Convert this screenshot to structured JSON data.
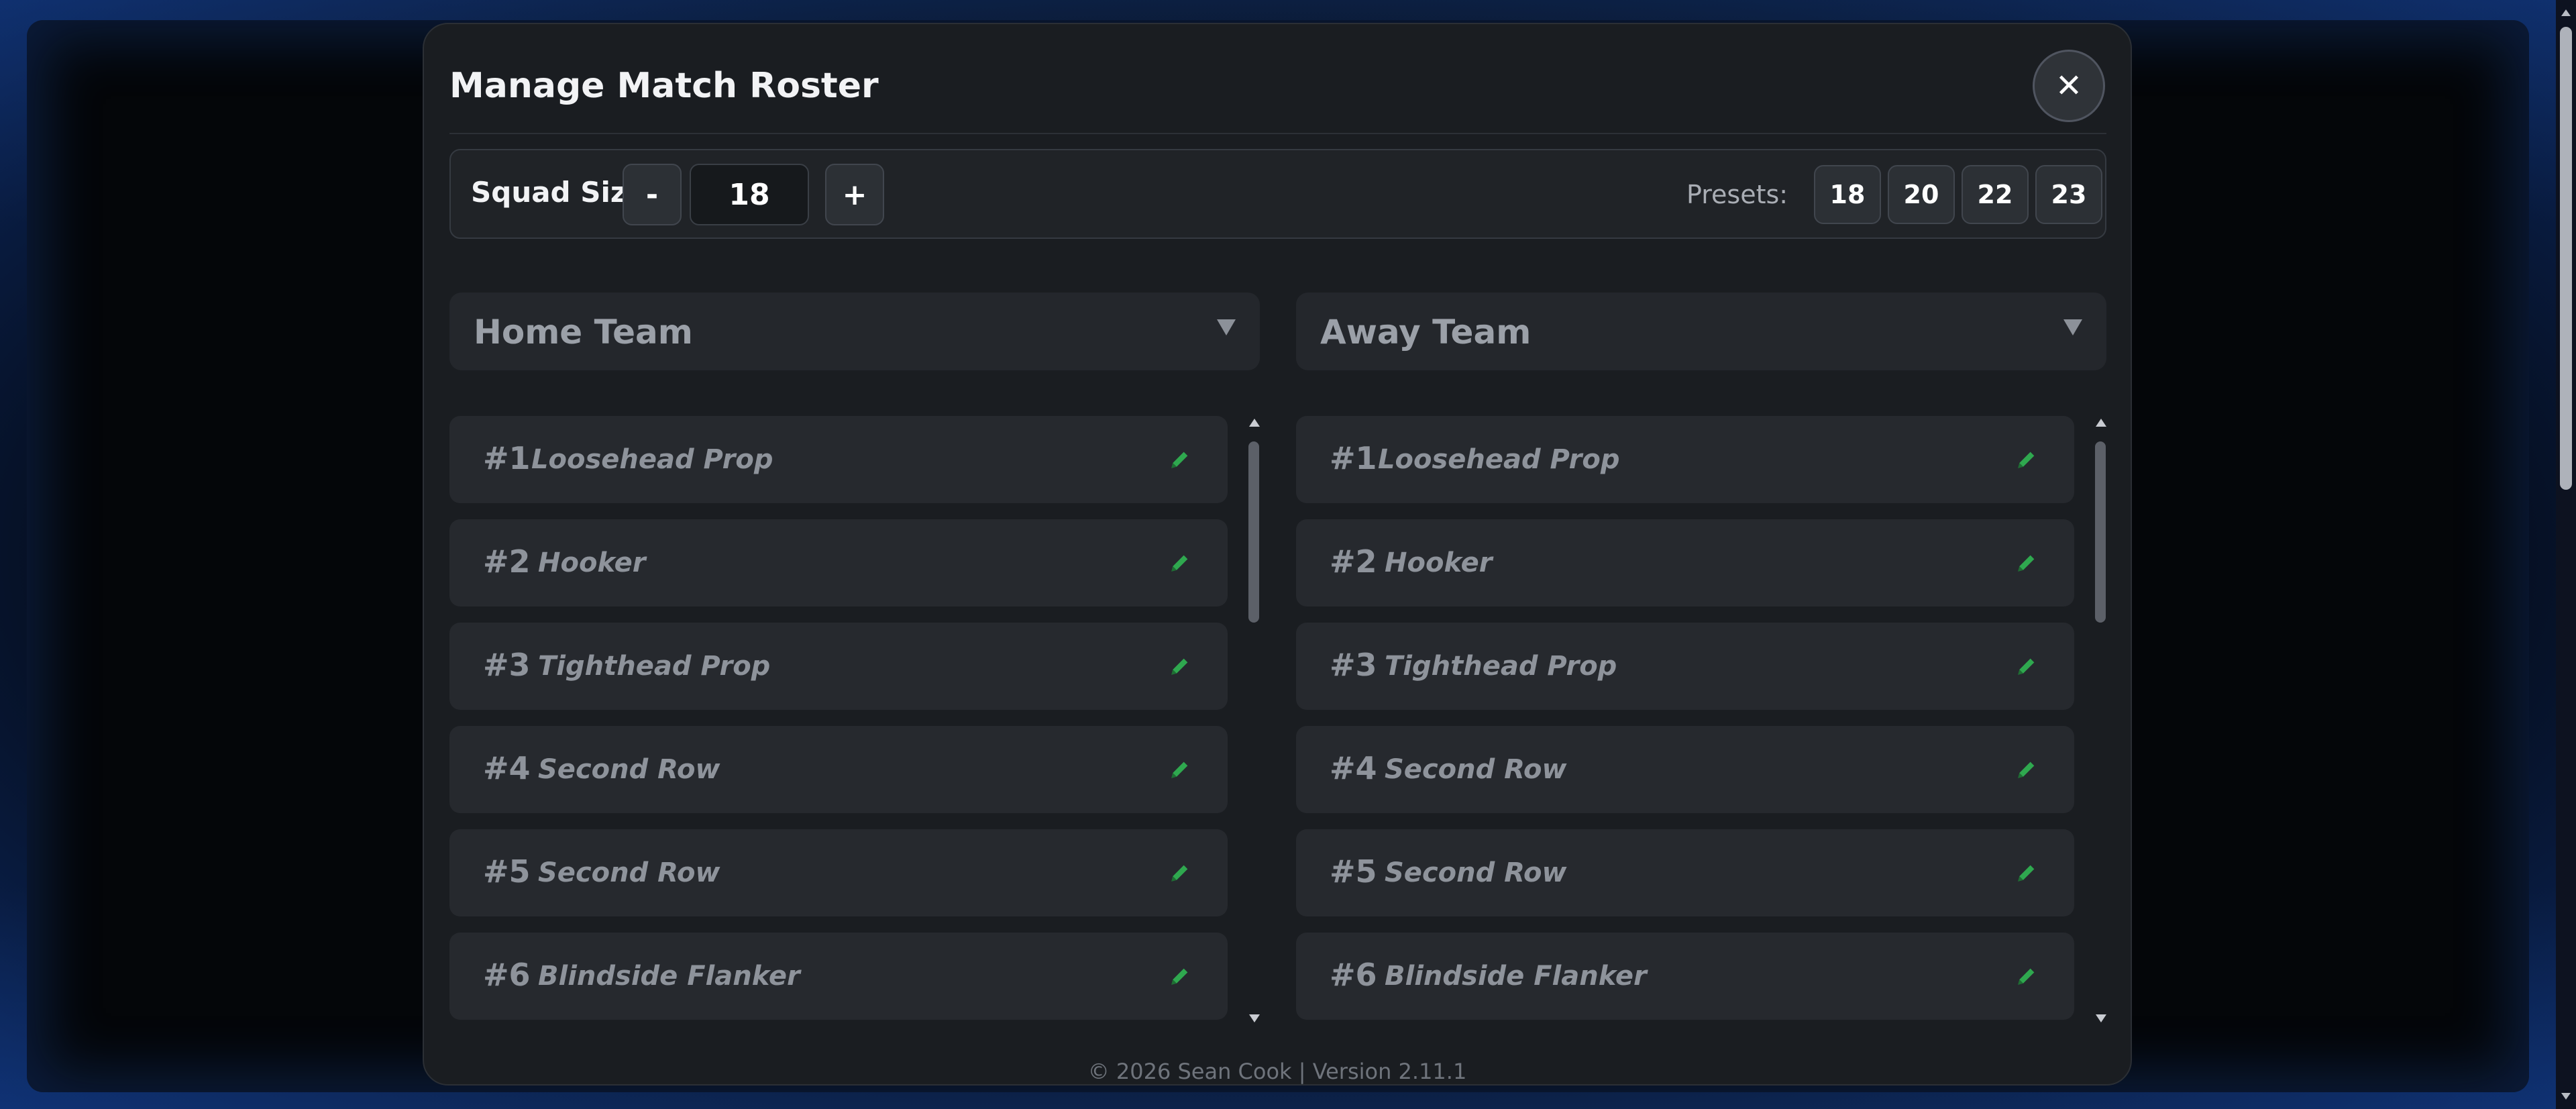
{
  "modal": {
    "title": "Manage Match Roster",
    "close_icon": "close-icon"
  },
  "squad": {
    "label": "Squad Size:",
    "minus_label": "-",
    "value": "18",
    "plus_label": "+",
    "presets_label": "Presets:",
    "presets": [
      "18",
      "20",
      "22",
      "23"
    ]
  },
  "home": {
    "title": "Home Team",
    "rows": [
      {
        "num": "#1",
        "pos": "Loosehead Prop"
      },
      {
        "num": "#2",
        "pos": "Hooker"
      },
      {
        "num": "#3",
        "pos": "Tighthead Prop"
      },
      {
        "num": "#4",
        "pos": "Second Row"
      },
      {
        "num": "#5",
        "pos": "Second Row"
      },
      {
        "num": "#6",
        "pos": "Blindside Flanker"
      }
    ]
  },
  "away": {
    "title": "Away Team",
    "rows": [
      {
        "num": "#1",
        "pos": "Loosehead Prop"
      },
      {
        "num": "#2",
        "pos": "Hooker"
      },
      {
        "num": "#3",
        "pos": "Tighthead Prop"
      },
      {
        "num": "#4",
        "pos": "Second Row"
      },
      {
        "num": "#5",
        "pos": "Second Row"
      },
      {
        "num": "#6",
        "pos": "Blindside Flanker"
      }
    ]
  },
  "footer": {
    "text": "© 2026 Sean Cook | Version 2.11.1"
  },
  "colors": {
    "accent_green": "#2fa84f",
    "modal_bg": "#1a1d21",
    "row_bg": "#26292e"
  }
}
